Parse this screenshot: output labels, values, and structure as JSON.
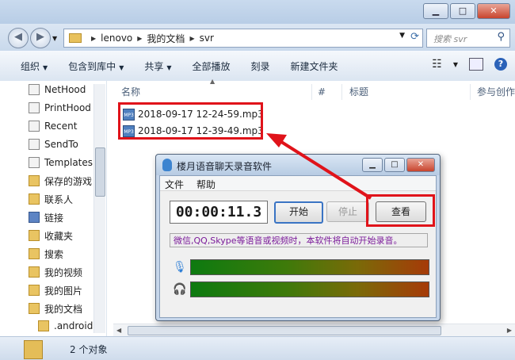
{
  "window": {
    "minimize_glyph": "▁",
    "maximize_glyph": "□",
    "close_glyph": "✕"
  },
  "address": {
    "crumbs": [
      "lenovo",
      "我的文档",
      "svr"
    ],
    "search_placeholder": "搜索 svr"
  },
  "toolbar": {
    "organize": "组织",
    "include_in_library": "包含到库中",
    "share": "共享",
    "play_all": "全部播放",
    "burn": "刻录",
    "new_folder": "新建文件夹"
  },
  "navpane": {
    "items": [
      "NetHood",
      "PrintHood",
      "Recent",
      "SendTo",
      "Templates",
      "保存的游戏",
      "联系人",
      "链接",
      "收藏夹",
      "搜索",
      "我的视频",
      "我的图片",
      "我的文档",
      ".android"
    ]
  },
  "columns": {
    "name": "名称",
    "number": "#",
    "title": "标题",
    "artists": "参与创作"
  },
  "files": [
    "2018-09-17 12-24-59.mp3",
    "2018-09-17 12-39-49.mp3"
  ],
  "status": {
    "count": "2 个对象"
  },
  "recorder": {
    "title": "楼月语音聊天录音软件",
    "menu": {
      "file": "文件",
      "help": "帮助"
    },
    "timer": "00:00:11.3",
    "start": "开始",
    "stop": "停止",
    "view": "查看",
    "message": "微信,QQ,Skype等语音或视频时，本软件将自动开始录音。"
  },
  "colors": {
    "annotation_red": "#e0131a",
    "message_purple": "#7b1b9a"
  }
}
